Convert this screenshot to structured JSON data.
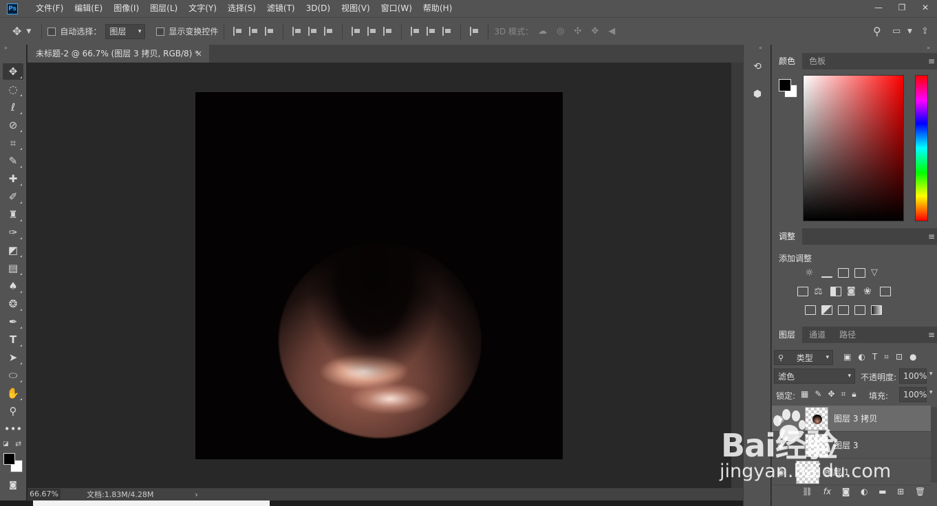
{
  "app": {
    "logo": "Ps"
  },
  "menu": [
    "文件(F)",
    "编辑(E)",
    "图像(I)",
    "图层(L)",
    "文字(Y)",
    "选择(S)",
    "滤镜(T)",
    "3D(D)",
    "视图(V)",
    "窗口(W)",
    "帮助(H)"
  ],
  "window_controls": {
    "minimize": "—",
    "restore": "❐",
    "close": "✕"
  },
  "options": {
    "auto_select_label": "自动选择：",
    "auto_select_value": "图层",
    "show_transform_label": "显示变换控件",
    "mode_3d_label": "3D 模式："
  },
  "document": {
    "tab_title": "未标题-2 @ 66.7% (图层 3 拷贝, RGB/8) *",
    "close": "×",
    "zoom": "66.67%",
    "doc_size": "文档:1.83M/4.28M",
    "status_arrow": "›"
  },
  "color_panel": {
    "tabs": [
      "颜色",
      "色板"
    ]
  },
  "adjust_panel": {
    "tab": "调整",
    "add_label": "添加调整"
  },
  "layers_panel": {
    "tabs": [
      "图层",
      "通道",
      "路径"
    ],
    "filter_kind": "类型",
    "blend_mode": "滤色",
    "opacity_label": "不透明度:",
    "opacity_value": "100%",
    "lock_label": "锁定:",
    "fill_label": "填充:",
    "fill_value": "100%",
    "layers": [
      {
        "name": "图层 3 拷贝"
      },
      {
        "name": "图层 3"
      },
      {
        "name": "图层 1"
      }
    ],
    "footer_fx": "fx"
  },
  "watermark": {
    "brand": "Bai经验",
    "site": "jingyan.baidu.com"
  },
  "colors": {
    "menubar": "#535353",
    "canvas_bg": "#282828",
    "document_fill": "#040202",
    "foreground": "#000000",
    "background": "#ffffff"
  }
}
